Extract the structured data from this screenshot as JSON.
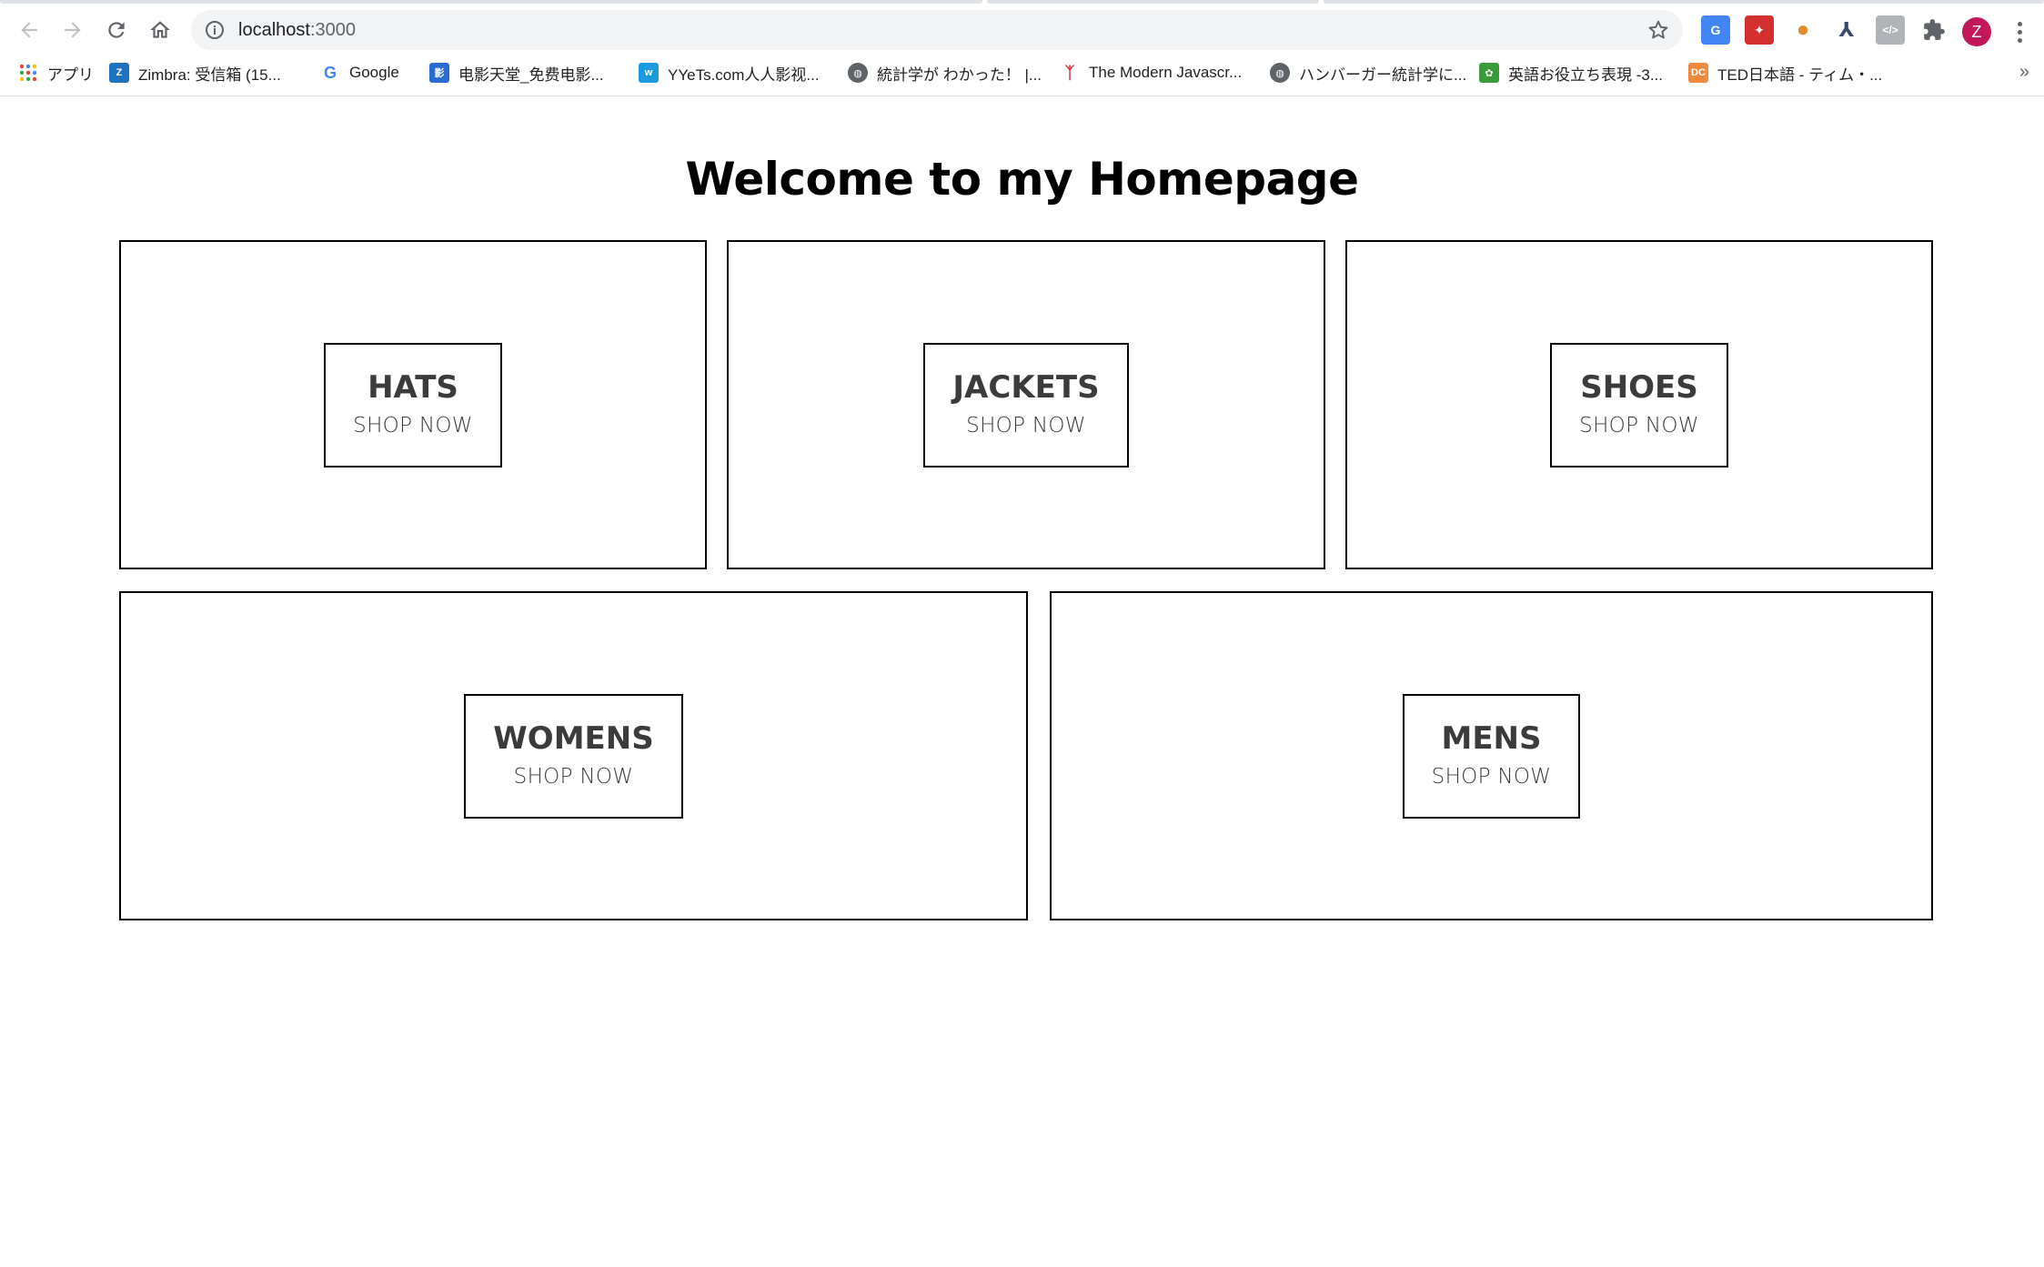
{
  "browser": {
    "url_host": "localhost",
    "url_port": ":3000",
    "avatar_letter": "Z",
    "bookmarks": [
      {
        "label": "アプリ",
        "icon": "apps-grid-icon"
      },
      {
        "label": "Zimbra: 受信箱 (15...",
        "icon": "zimbra-icon"
      },
      {
        "label": "Google",
        "icon": "google-icon"
      },
      {
        "label": "电影天堂_免费电影...",
        "icon": "dytt-icon"
      },
      {
        "label": "YYeTs.com人人影视...",
        "icon": "yyets-icon"
      },
      {
        "label": "統計学が わかった！ |...",
        "icon": "globe-icon"
      },
      {
        "label": "The Modern Javascr...",
        "icon": "js-icon"
      },
      {
        "label": "ハンバーガー統計学に...",
        "icon": "globe-icon"
      },
      {
        "label": "英語お役立ち表現 -3...",
        "icon": "frog-icon"
      },
      {
        "label": "TED日本語 - ティム・...",
        "icon": "dc-icon"
      }
    ],
    "more_label": "»"
  },
  "page": {
    "title": "Welcome to my Homepage",
    "categories": [
      {
        "name": "HATS",
        "cta": "SHOP NOW"
      },
      {
        "name": "JACKETS",
        "cta": "SHOP NOW"
      },
      {
        "name": "SHOES",
        "cta": "SHOP NOW"
      },
      {
        "name": "WOMENS",
        "cta": "SHOP NOW"
      },
      {
        "name": "MENS",
        "cta": "SHOP NOW"
      }
    ]
  }
}
